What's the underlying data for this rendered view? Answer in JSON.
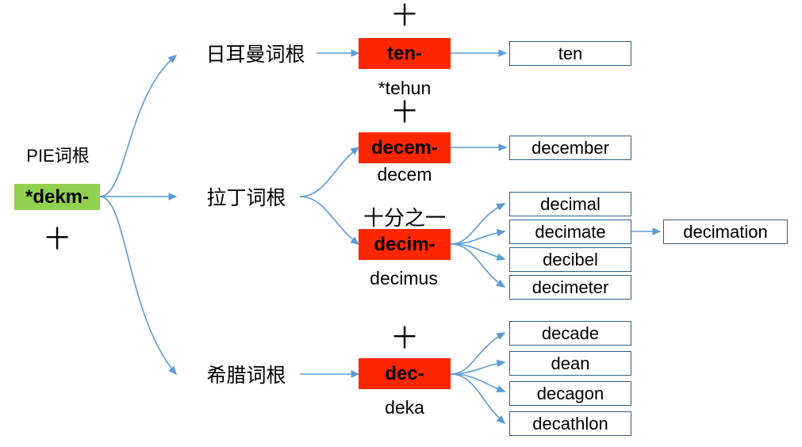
{
  "diagram": {
    "title": "PIE root derivation tree",
    "colors": {
      "root_fill": "#92d050",
      "branch_fill": "#ff2600",
      "box_border": "#2d5f8b",
      "edge": "#5b9bd5"
    },
    "root": {
      "label": "PIE词根",
      "term": "*dekm-",
      "plus": "十"
    },
    "branches": [
      {
        "name": "germanic",
        "label": "日耳曼词根",
        "plus": "十",
        "term": "ten-",
        "sub": "*tehun",
        "outputs": [
          "ten"
        ]
      },
      {
        "name": "latin",
        "label": "拉丁词根",
        "groups": [
          {
            "name": "decem",
            "plus": "十",
            "term": "decem-",
            "sub": "decem",
            "outputs": [
              "december"
            ]
          },
          {
            "name": "decim",
            "plus": "十分之一",
            "term": "decim-",
            "sub": "decimus",
            "outputs": [
              "decimal",
              "decimate",
              "decibel",
              "decimeter"
            ],
            "second_level": {
              "from": "decimate",
              "outputs": [
                "decimation"
              ]
            }
          }
        ]
      },
      {
        "name": "greek",
        "label": "希腊词根",
        "plus": "十",
        "term": "dec-",
        "sub": "deka",
        "outputs": [
          "decade",
          "dean",
          "decagon",
          "decathlon"
        ]
      }
    ]
  }
}
